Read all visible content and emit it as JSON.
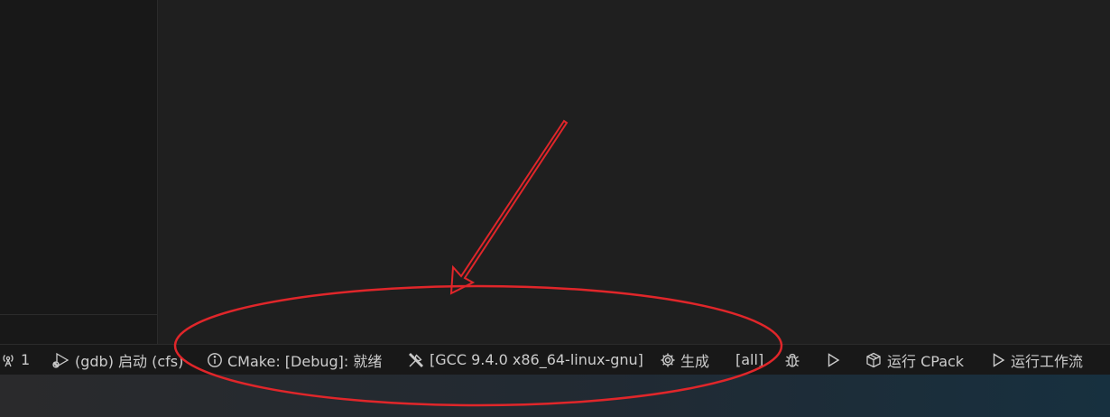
{
  "status_bar": {
    "ports": {
      "icon": "broadcast-icon",
      "label": "1"
    },
    "debug_launch": {
      "icon": "debug-launch-icon",
      "label": "(gdb) 启动 (cfs)"
    },
    "cmake_status": {
      "icon": "info-icon",
      "label": "CMake: [Debug]: 就绪"
    },
    "kit": {
      "icon": "tools-icon",
      "label": "[GCC 9.4.0 x86_64-linux-gnu]"
    },
    "build": {
      "icon": "gear-icon",
      "label": "生成"
    },
    "target": {
      "label": "[all]"
    },
    "debug": {
      "icon": "bug-icon"
    },
    "run": {
      "icon": "play-icon"
    },
    "cpack": {
      "icon": "package-icon",
      "label": "运行 CPack"
    },
    "workflow": {
      "icon": "play-icon",
      "label": "运行工作流"
    }
  },
  "colors": {
    "status_text": "#cccccc",
    "annotation_red": "#e0262a",
    "editor_background": "#1f1f1f"
  }
}
